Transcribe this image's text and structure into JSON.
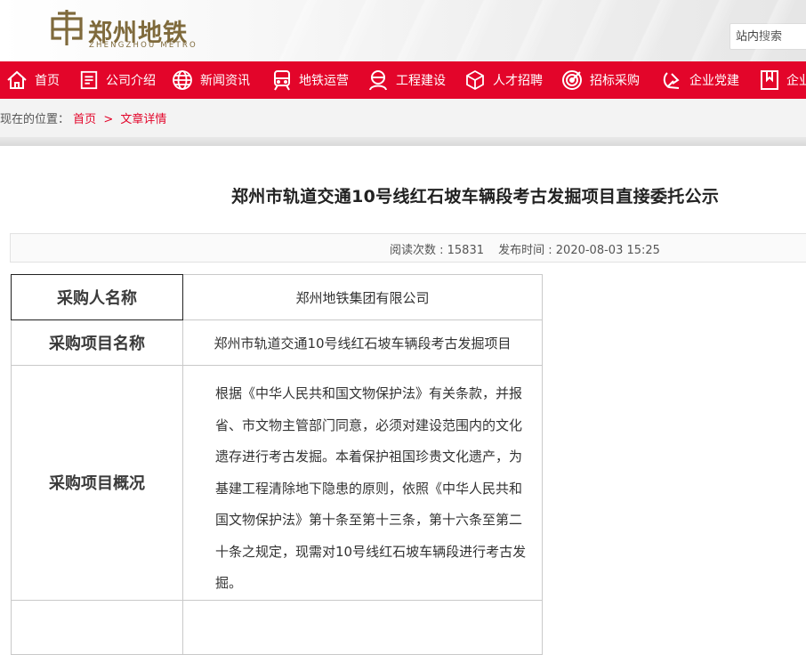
{
  "brand": {
    "name_cn": "郑州地铁",
    "name_en": "ZHENGZHOU METRO",
    "color": "#7f6a3c"
  },
  "search": {
    "placeholder": "站内搜索"
  },
  "nav": {
    "color": "#e3052a",
    "items": [
      {
        "label": "首页",
        "icon": "home-icon"
      },
      {
        "label": "公司介绍",
        "icon": "company-icon"
      },
      {
        "label": "新闻资讯",
        "icon": "globe-icon"
      },
      {
        "label": "地铁运营",
        "icon": "train-icon"
      },
      {
        "label": "工程建设",
        "icon": "worker-icon"
      },
      {
        "label": "人才招聘",
        "icon": "cube-icon"
      },
      {
        "label": "招标采购",
        "icon": "target-icon"
      },
      {
        "label": "企业党建",
        "icon": "party-emblem-icon"
      },
      {
        "label": "企业",
        "icon": "book-icon"
      }
    ]
  },
  "breadcrumb": {
    "prefix": "现在的位置：",
    "home": "首页",
    "separator": ">",
    "current": "文章详情"
  },
  "article": {
    "title": "郑州市轨道交通10号线红石坡车辆段考古发掘项目直接委托公示",
    "read_count": "阅读次数 : 15831",
    "publish_time": "发布时间 : 2020-08-03 15:25"
  },
  "table": {
    "rows": [
      {
        "label": "采购人名称",
        "value": "郑州地铁集团有限公司"
      },
      {
        "label": "采购项目名称",
        "value": "郑州市轨道交通10号线红石坡车辆段考古发掘项目"
      },
      {
        "label": "采购项目概况",
        "value": "根据《中华人民共和国文物保护法》有关条款，并报省、市文物主管部门同意，必须对建设范围内的文化遗存进行考古发掘。本着保护祖国珍贵文化遗产，为基建工程清除地下隐患的原则，依照《中华人民共和国文物保护法》第十条至第十三条，第十六条至第二十条之规定，现需对10号线红石坡车辆段进行考古发掘。"
      }
    ]
  }
}
